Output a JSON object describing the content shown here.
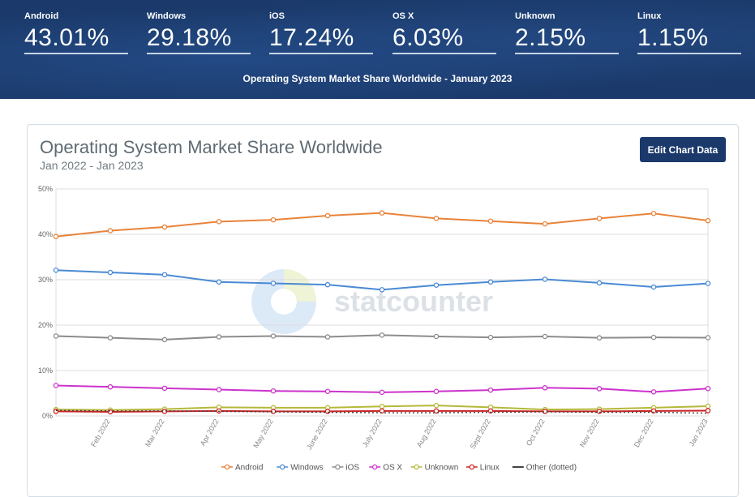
{
  "banner": {
    "title": "Operating System Market Share Worldwide - January 2023",
    "stats": [
      {
        "label": "Android",
        "value": "43.01%"
      },
      {
        "label": "Windows",
        "value": "29.18%"
      },
      {
        "label": "iOS",
        "value": "17.24%"
      },
      {
        "label": "OS X",
        "value": "6.03%"
      },
      {
        "label": "Unknown",
        "value": "2.15%"
      },
      {
        "label": "Linux",
        "value": "1.15%"
      }
    ]
  },
  "card": {
    "title": "Operating System Market Share Worldwide",
    "subtitle": "Jan 2022 - Jan 2023",
    "edit_button": "Edit Chart Data",
    "watermark": "statcounter"
  },
  "chart_data": {
    "type": "line",
    "categories": [
      "Jan 2022",
      "Feb 2022",
      "Mar 2022",
      "Apr 2022",
      "May 2022",
      "June 2022",
      "July 2022",
      "Aug 2022",
      "Sept 2022",
      "Oct 2022",
      "Nov 2022",
      "Dec 2022",
      "Jan 2023"
    ],
    "x_tick_labels": [
      "Feb 2022",
      "Mar 2022",
      "Apr 2022",
      "May 2022",
      "June 2022",
      "July 2022",
      "Aug 2022",
      "Sept 2022",
      "Oct 2022",
      "Nov 2022",
      "Dec 2022",
      "Jan 2023"
    ],
    "ylim": [
      0,
      50
    ],
    "y_ticks": [
      0,
      10,
      20,
      30,
      40,
      50
    ],
    "y_tick_labels": [
      "0%",
      "10%",
      "20%",
      "30%",
      "40%",
      "50%"
    ],
    "grid": true,
    "legend_position": "bottom",
    "series": [
      {
        "name": "Android",
        "color": "#e8833a",
        "values": [
          39.5,
          40.8,
          41.6,
          42.8,
          43.2,
          44.1,
          44.7,
          43.5,
          42.9,
          42.3,
          43.5,
          44.6,
          43.01
        ]
      },
      {
        "name": "Windows",
        "color": "#4a8ad4",
        "values": [
          32.1,
          31.6,
          31.1,
          29.5,
          29.2,
          28.9,
          27.8,
          28.8,
          29.5,
          30.1,
          29.3,
          28.4,
          29.18
        ]
      },
      {
        "name": "iOS",
        "color": "#8c8c8c",
        "values": [
          17.6,
          17.2,
          16.8,
          17.4,
          17.6,
          17.4,
          17.8,
          17.5,
          17.3,
          17.5,
          17.2,
          17.3,
          17.24
        ]
      },
      {
        "name": "OS X",
        "color": "#cc33cc",
        "values": [
          6.7,
          6.4,
          6.1,
          5.8,
          5.5,
          5.4,
          5.2,
          5.4,
          5.7,
          6.2,
          6.0,
          5.3,
          6.03
        ]
      },
      {
        "name": "Unknown",
        "color": "#b5b83a",
        "values": [
          1.4,
          1.3,
          1.5,
          1.9,
          1.8,
          1.8,
          2.1,
          2.3,
          1.9,
          1.4,
          1.5,
          1.8,
          2.15
        ]
      },
      {
        "name": "Linux",
        "color": "#cc2222",
        "values": [
          1.0,
          0.9,
          1.0,
          1.1,
          1.0,
          1.0,
          1.1,
          1.1,
          1.1,
          1.0,
          1.0,
          1.1,
          1.15
        ]
      },
      {
        "name": "Other (dotted)",
        "color": "#444444",
        "dotted": true,
        "values": [
          1.2,
          1.1,
          1.1,
          1.0,
          0.9,
          0.8,
          0.7,
          0.7,
          0.8,
          0.9,
          0.8,
          0.8,
          0.6
        ]
      }
    ]
  }
}
